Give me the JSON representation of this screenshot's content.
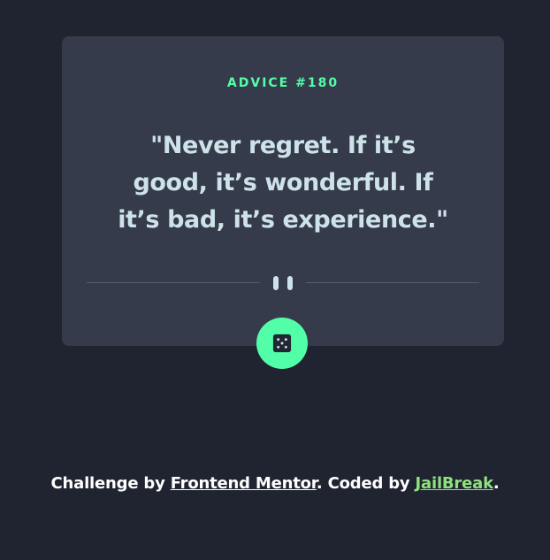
{
  "card": {
    "advice_label": "ADVICE #180",
    "advice_text": "\"Never regret. If it’s good, it’s wonderful. If it’s bad, it’s experience.\""
  },
  "divider": {
    "icon": "pause-icon"
  },
  "button": {
    "icon": "dice-icon"
  },
  "footer": {
    "prefix": "Challenge by ",
    "frontend_mentor": "Frontend Mentor",
    "middle": ". Coded by ",
    "author": "JailBreak",
    "suffix": "."
  },
  "colors": {
    "background": "#1f2430",
    "card": "#353b4a",
    "accent": "#52ffa8",
    "text": "#cee3e9",
    "author_link": "#8ee27d"
  }
}
